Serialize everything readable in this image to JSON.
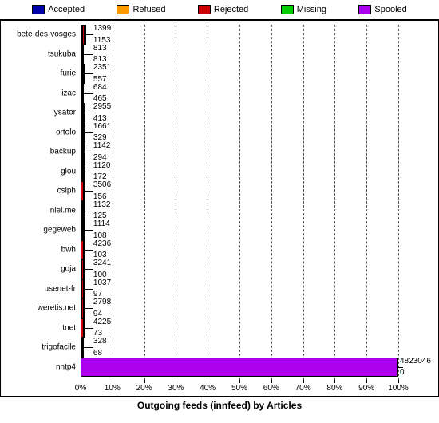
{
  "legend": [
    {
      "label": "Accepted",
      "color": "#0000aa"
    },
    {
      "label": "Refused",
      "color": "#ff9900"
    },
    {
      "label": "Rejected",
      "color": "#cc0000"
    },
    {
      "label": "Missing",
      "color": "#00cc00"
    },
    {
      "label": "Spooled",
      "color": "#aa00ee"
    }
  ],
  "x_ticks": [
    "0%",
    "10%",
    "20%",
    "30%",
    "40%",
    "50%",
    "60%",
    "70%",
    "80%",
    "90%",
    "100%"
  ],
  "x_title": "Outgoing feeds (innfeed) by Articles",
  "chart_data": {
    "type": "bar",
    "orientation": "horizontal",
    "stacked": true,
    "xlabel": "Outgoing feeds (innfeed) by Articles",
    "xlim_percent": [
      0,
      100
    ],
    "series_names": [
      "Accepted",
      "Refused",
      "Rejected",
      "Missing",
      "Spooled"
    ],
    "rows": [
      {
        "name": "bete-des-vosges",
        "top_value": 1399,
        "bot_value": 1153,
        "segs": [
          {
            "c": "#00cc00",
            "w": 0.6
          },
          {
            "c": "#cc0000",
            "w": 0.6
          },
          {
            "c": "#0000aa",
            "w": 0.3
          }
        ]
      },
      {
        "name": "tsukuba",
        "top_value": 813,
        "bot_value": 813,
        "segs": [
          {
            "c": "#cc0000",
            "w": 0.4
          },
          {
            "c": "#0000aa",
            "w": 0.7
          }
        ]
      },
      {
        "name": "furie",
        "top_value": 2351,
        "bot_value": 557,
        "segs": [
          {
            "c": "#00cc00",
            "w": 0.4
          },
          {
            "c": "#cc0000",
            "w": 0.4
          },
          {
            "c": "#0000aa",
            "w": 0.2
          }
        ]
      },
      {
        "name": "izac",
        "top_value": 684,
        "bot_value": 465,
        "segs": [
          {
            "c": "#00cc00",
            "w": 0.3
          },
          {
            "c": "#cc0000",
            "w": 0.3
          },
          {
            "c": "#0000aa",
            "w": 0.5
          }
        ]
      },
      {
        "name": "lysator",
        "top_value": 2955,
        "bot_value": 413,
        "segs": [
          {
            "c": "#00cc00",
            "w": 0.4
          },
          {
            "c": "#cc0000",
            "w": 0.4
          },
          {
            "c": "#0000aa",
            "w": 0.2
          }
        ]
      },
      {
        "name": "ortolo",
        "top_value": 1661,
        "bot_value": 329,
        "segs": [
          {
            "c": "#00cc00",
            "w": 0.6
          },
          {
            "c": "#cc0000",
            "w": 0.4
          },
          {
            "c": "#0000aa",
            "w": 0.2
          }
        ]
      },
      {
        "name": "backup",
        "top_value": 1142,
        "bot_value": 294,
        "segs": [
          {
            "c": "#00cc00",
            "w": 0.3
          },
          {
            "c": "#cc0000",
            "w": 0.5
          },
          {
            "c": "#0000aa",
            "w": 0.3
          }
        ]
      },
      {
        "name": "glou",
        "top_value": 1120,
        "bot_value": 172,
        "segs": [
          {
            "c": "#00cc00",
            "w": 0.5
          },
          {
            "c": "#cc0000",
            "w": 0.5
          },
          {
            "c": "#0000aa",
            "w": 0.2
          }
        ]
      },
      {
        "name": "csiph",
        "top_value": 3506,
        "bot_value": 156,
        "segs": [
          {
            "c": "#cc0000",
            "w": 0.9
          },
          {
            "c": "#0000aa",
            "w": 0.1
          }
        ]
      },
      {
        "name": "niel.me",
        "top_value": 1132,
        "bot_value": 125,
        "segs": [
          {
            "c": "#00cc00",
            "w": 0.5
          },
          {
            "c": "#cc0000",
            "w": 0.5
          },
          {
            "c": "#0000aa",
            "w": 0.2
          }
        ]
      },
      {
        "name": "gegeweb",
        "top_value": 1114,
        "bot_value": 108,
        "segs": [
          {
            "c": "#00cc00",
            "w": 0.4
          },
          {
            "c": "#cc0000",
            "w": 0.5
          },
          {
            "c": "#0000aa",
            "w": 0.2
          }
        ]
      },
      {
        "name": "bwh",
        "top_value": 4236,
        "bot_value": 103,
        "segs": [
          {
            "c": "#cc0000",
            "w": 0.9
          },
          {
            "c": "#0000aa",
            "w": 0.1
          }
        ]
      },
      {
        "name": "goja",
        "top_value": 3241,
        "bot_value": 100,
        "segs": [
          {
            "c": "#00cc00",
            "w": 0.3
          },
          {
            "c": "#cc0000",
            "w": 0.6
          },
          {
            "c": "#0000aa",
            "w": 0.1
          }
        ]
      },
      {
        "name": "usenet-fr",
        "top_value": 1037,
        "bot_value": 97,
        "segs": [
          {
            "c": "#00cc00",
            "w": 0.3
          },
          {
            "c": "#cc0000",
            "w": 0.6
          },
          {
            "c": "#0000aa",
            "w": 0.2
          }
        ]
      },
      {
        "name": "weretis.net",
        "top_value": 2798,
        "bot_value": 94,
        "segs": [
          {
            "c": "#00cc00",
            "w": 0.3
          },
          {
            "c": "#cc0000",
            "w": 0.6
          },
          {
            "c": "#0000aa",
            "w": 0.1
          }
        ]
      },
      {
        "name": "tnet",
        "top_value": 4225,
        "bot_value": 73,
        "segs": [
          {
            "c": "#cc0000",
            "w": 0.9
          },
          {
            "c": "#0000aa",
            "w": 0.05
          }
        ]
      },
      {
        "name": "trigofacile",
        "top_value": 328,
        "bot_value": 68,
        "segs": [
          {
            "c": "#00cc00",
            "w": 0.3
          },
          {
            "c": "#cc0000",
            "w": 0.3
          },
          {
            "c": "#0000aa",
            "w": 0.3
          }
        ]
      },
      {
        "name": "nntp4",
        "top_value": 4823046,
        "bot_value": 0,
        "segs": [
          {
            "c": "#aa00ee",
            "w": 100
          }
        ],
        "right_label": true
      }
    ]
  }
}
